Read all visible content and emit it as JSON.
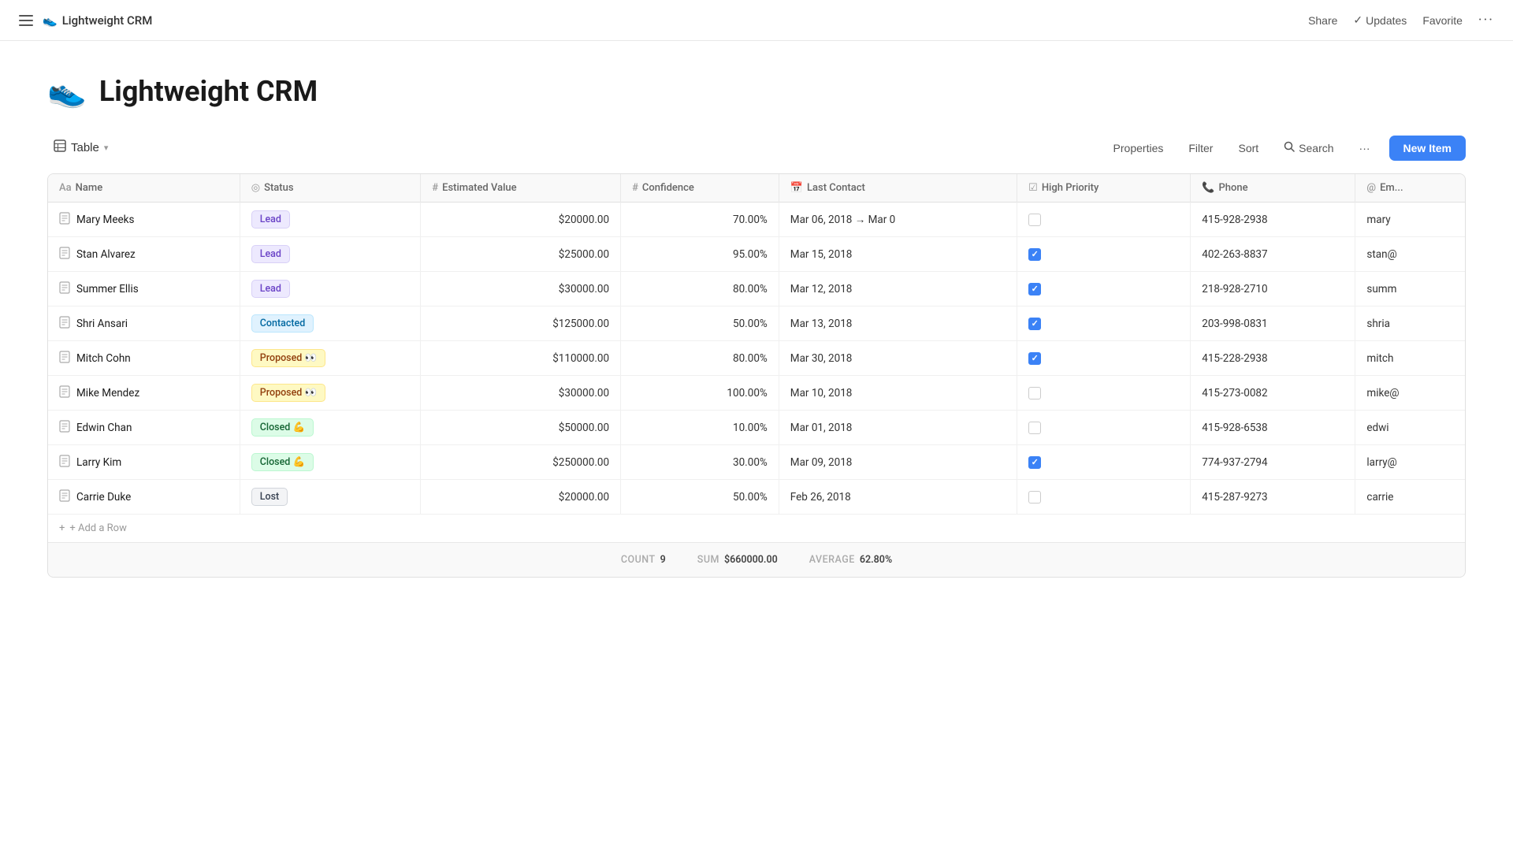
{
  "app": {
    "icon": "👟",
    "title": "Lightweight CRM"
  },
  "nav": {
    "share_label": "Share",
    "updates_label": "Updates",
    "favorite_label": "Favorite"
  },
  "page": {
    "icon": "👟",
    "title": "Lightweight CRM"
  },
  "toolbar": {
    "view_label": "Table",
    "properties_label": "Properties",
    "filter_label": "Filter",
    "sort_label": "Sort",
    "search_label": "Search",
    "more_label": "···",
    "new_item_label": "New Item"
  },
  "columns": [
    {
      "id": "name",
      "icon": "Aa",
      "label": "Name"
    },
    {
      "id": "status",
      "icon": "◎",
      "label": "Status"
    },
    {
      "id": "value",
      "icon": "#",
      "label": "Estimated Value"
    },
    {
      "id": "confidence",
      "icon": "#",
      "label": "Confidence"
    },
    {
      "id": "last_contact",
      "icon": "📅",
      "label": "Last Contact"
    },
    {
      "id": "high_priority",
      "icon": "☑",
      "label": "High Priority"
    },
    {
      "id": "phone",
      "icon": "📞",
      "label": "Phone"
    },
    {
      "id": "email",
      "icon": "@",
      "label": "Em..."
    }
  ],
  "rows": [
    {
      "name": "Mary Meeks",
      "status": "Lead",
      "status_type": "lead",
      "value": "$20000.00",
      "confidence": "70.00%",
      "last_contact": "Mar 06, 2018 → Mar 0",
      "high_priority": false,
      "phone": "415-928-2938",
      "email": "mary"
    },
    {
      "name": "Stan Alvarez",
      "status": "Lead",
      "status_type": "lead",
      "value": "$25000.00",
      "confidence": "95.00%",
      "last_contact": "Mar 15, 2018",
      "high_priority": true,
      "phone": "402-263-8837",
      "email": "stan@"
    },
    {
      "name": "Summer Ellis",
      "status": "Lead",
      "status_type": "lead",
      "value": "$30000.00",
      "confidence": "80.00%",
      "last_contact": "Mar 12, 2018",
      "high_priority": true,
      "phone": "218-928-2710",
      "email": "summ"
    },
    {
      "name": "Shri Ansari",
      "status": "Contacted",
      "status_type": "contacted",
      "value": "$125000.00",
      "confidence": "50.00%",
      "last_contact": "Mar 13, 2018",
      "high_priority": true,
      "phone": "203-998-0831",
      "email": "shria"
    },
    {
      "name": "Mitch Cohn",
      "status": "Proposed 👀",
      "status_type": "proposed",
      "value": "$110000.00",
      "confidence": "80.00%",
      "last_contact": "Mar 30, 2018",
      "high_priority": true,
      "phone": "415-228-2938",
      "email": "mitch"
    },
    {
      "name": "Mike Mendez",
      "status": "Proposed 👀",
      "status_type": "proposed",
      "value": "$30000.00",
      "confidence": "100.00%",
      "last_contact": "Mar 10, 2018",
      "high_priority": false,
      "phone": "415-273-0082",
      "email": "mike@"
    },
    {
      "name": "Edwin Chan",
      "status": "Closed 💪",
      "status_type": "closed",
      "value": "$50000.00",
      "confidence": "10.00%",
      "last_contact": "Mar 01, 2018",
      "high_priority": false,
      "phone": "415-928-6538",
      "email": "edwi"
    },
    {
      "name": "Larry Kim",
      "status": "Closed 💪",
      "status_type": "closed",
      "value": "$250000.00",
      "confidence": "30.00%",
      "last_contact": "Mar 09, 2018",
      "high_priority": true,
      "phone": "774-937-2794",
      "email": "larry@"
    },
    {
      "name": "Carrie Duke",
      "status": "Lost",
      "status_type": "lost",
      "value": "$20000.00",
      "confidence": "50.00%",
      "last_contact": "Feb 26, 2018",
      "high_priority": false,
      "phone": "415-287-9273",
      "email": "carrie"
    }
  ],
  "add_row_label": "+ Add a Row",
  "footer": {
    "count_label": "COUNT",
    "count_value": "9",
    "sum_label": "SUM",
    "sum_value": "$660000.00",
    "average_label": "AVERAGE",
    "average_value": "62.80%"
  }
}
